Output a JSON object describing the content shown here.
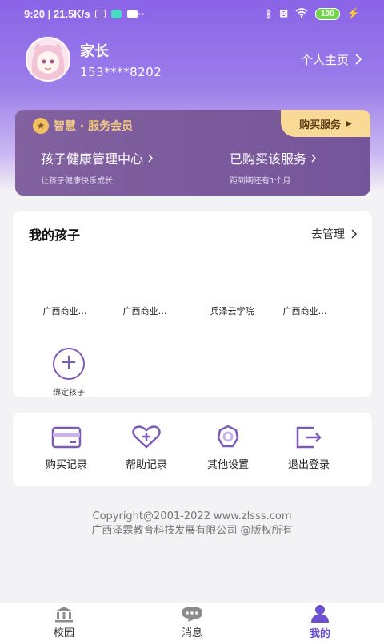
{
  "status_bar": {
    "time": "9:20",
    "speed": "21.5K/s",
    "battery": "100"
  },
  "profile": {
    "name": "家长",
    "phone": "153****8202",
    "homepage_label": "个人主页"
  },
  "vip": {
    "title": "智慧 · 服务会员",
    "buy_label": "购买服务",
    "left_title": "孩子健康管理中心",
    "left_sub": "让孩子健康快乐成长",
    "right_title": "已购买该服务",
    "right_sub": "距到期还有1个月",
    "colors": {
      "card": "#7a5a9c",
      "gold": "#f3cb86",
      "tag": "#f9d996"
    }
  },
  "kids": {
    "title": "我的孩子",
    "manage_label": "去管理",
    "items": [
      "广西商业…",
      "广西商业…",
      "兵泽云学院",
      "广西商业…"
    ],
    "bind_label": "绑定孩子"
  },
  "actions": [
    {
      "label": "购买记录",
      "icon": "card-icon"
    },
    {
      "label": "帮助记录",
      "icon": "heart-plus-icon"
    },
    {
      "label": "其他设置",
      "icon": "gear-icon"
    },
    {
      "label": "退出登录",
      "icon": "logout-icon"
    }
  ],
  "footer": {
    "line1": "Copyright@2001-2022 www.zlsss.com",
    "line2": "广西泽霖教育科技发展有限公司 @版权所有"
  },
  "tabs": [
    {
      "label": "校园",
      "icon": "campus-icon",
      "active": false
    },
    {
      "label": "消息",
      "icon": "chat-icon",
      "active": false
    },
    {
      "label": "我的",
      "icon": "user-icon",
      "active": true
    }
  ],
  "accent": "#6c4fcf"
}
